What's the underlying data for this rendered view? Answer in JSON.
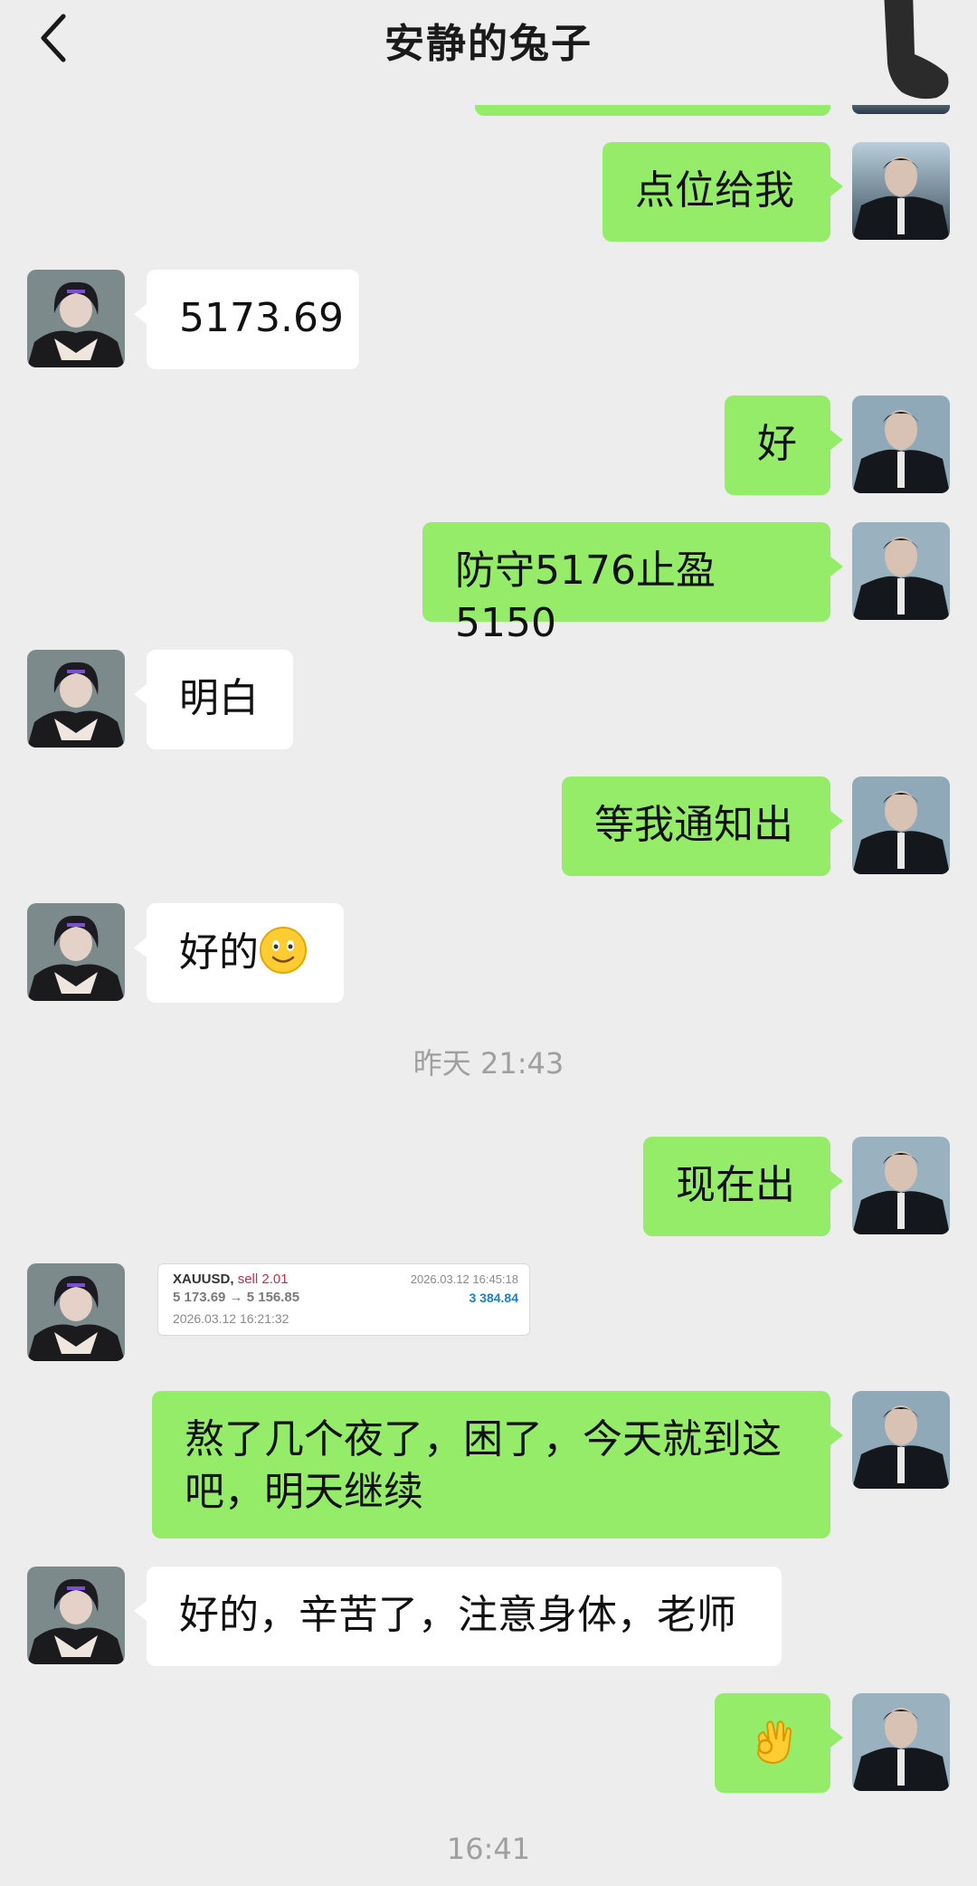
{
  "header": {
    "title": "安静的兔子"
  },
  "messages": [
    {
      "text": "点位给我"
    },
    {
      "text": "5173.69"
    },
    {
      "text": "好"
    },
    {
      "text": "防守5176止盈5150"
    },
    {
      "text": "明白"
    },
    {
      "text": "等我通知出"
    },
    {
      "text": "好的",
      "emoji": "slightly-smiling-face-icon"
    },
    {
      "text": "现在出"
    },
    {
      "text": "熬了几个夜了，困了，今天就到这吧，明天继续"
    },
    {
      "text": "好的，辛苦了，注意身体，老师"
    },
    {
      "emoji": "ok-hand-icon"
    }
  ],
  "timestamps": {
    "t1": "昨天 21:43",
    "t2": "16:41"
  },
  "trade_card": {
    "symbol": "XAUUSD,",
    "side": "sell 2.01",
    "close_time": "2026.03.12 16:45:18",
    "prices": "5 173.69 → 5 156.85",
    "profit": "3 384.84",
    "open_time": "2026.03.12 16:21:32"
  },
  "colors": {
    "background": "#ededed",
    "my_bubble": "#95ec69",
    "their_bubble": "#ffffff"
  }
}
